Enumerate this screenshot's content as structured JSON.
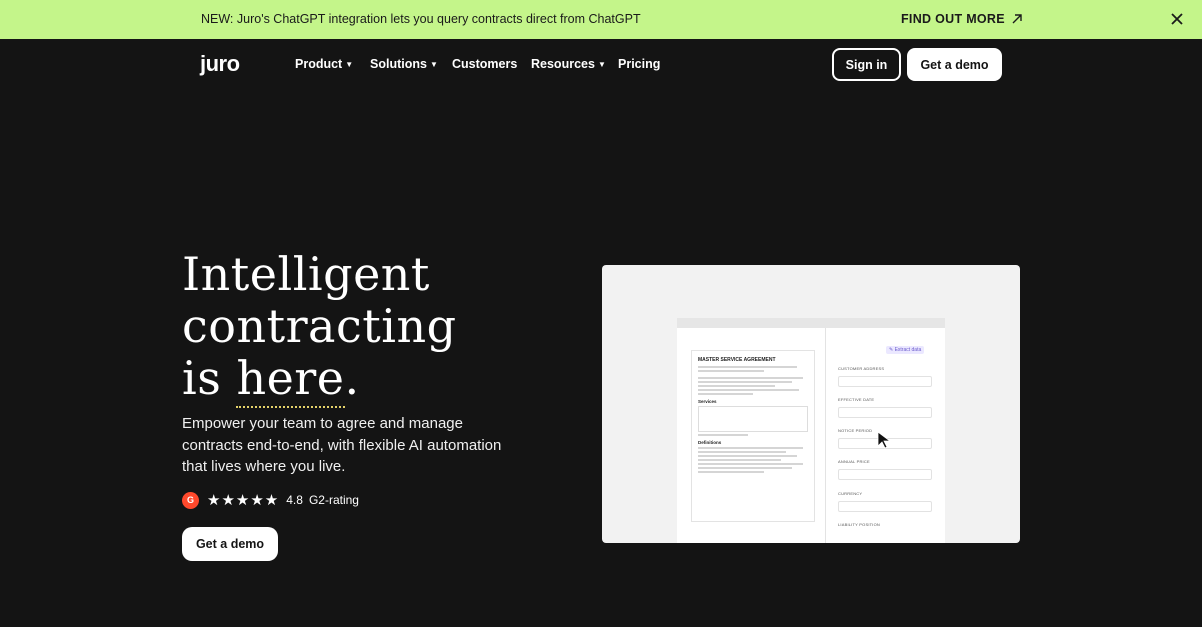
{
  "banner": {
    "message": "NEW: Juro's ChatGPT integration lets you query contracts direct from ChatGPT",
    "cta": "FIND OUT MORE"
  },
  "nav": {
    "logo": "juro",
    "items": [
      {
        "label": "Product",
        "has_caret": true
      },
      {
        "label": "Solutions",
        "has_caret": true
      },
      {
        "label": "Customers",
        "has_caret": false
      },
      {
        "label": "Resources",
        "has_caret": true
      },
      {
        "label": "Pricing",
        "has_caret": false
      }
    ],
    "sign_in": "Sign in",
    "get_demo": "Get a demo"
  },
  "hero": {
    "title_line1": "Intelligent",
    "title_line2": "contracting",
    "title_line3a": "is ",
    "title_line3b": "here",
    "title_line3c": ".",
    "subtitle": "Empower your team to agree and manage contracts end-to-end, with flexible AI automation that lives where you live.",
    "rating_badge": "G",
    "stars": "★★★★★",
    "rating_score": "4.8",
    "rating_label": "G2-rating",
    "cta": "Get a demo"
  },
  "preview": {
    "doc_title": "MASTER SERVICE AGREEMENT",
    "section_services": "Services",
    "section_definitions": "Definitions",
    "extract_button": "✎ Extract data",
    "fields": [
      "CUSTOMER ADDRESS",
      "EFFECTIVE DATE",
      "NOTICE PERIOD",
      "ANNUAL PRICE",
      "CURRENCY",
      "LIABILITY POSITION"
    ]
  },
  "colors": {
    "banner_bg": "#c4f58a",
    "page_bg": "#141414",
    "g2_red": "#ff492c"
  }
}
